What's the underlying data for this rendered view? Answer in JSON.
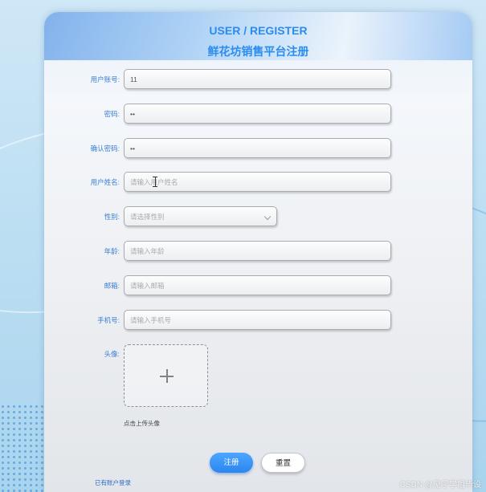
{
  "header": {
    "title_en": "USER / REGISTER",
    "title_cn": "鲜花坊销售平台注册"
  },
  "form": {
    "fields": [
      {
        "label": "用户账号:",
        "value": "11",
        "placeholder": ""
      },
      {
        "label": "密码:",
        "value": "••",
        "placeholder": ""
      },
      {
        "label": "确认密码:",
        "value": "••",
        "placeholder": ""
      },
      {
        "label": "用户姓名:",
        "value": "",
        "placeholder": "请输入用户姓名"
      },
      {
        "label": "性别:",
        "value": "",
        "placeholder": "请选择性别"
      },
      {
        "label": "年龄:",
        "value": "",
        "placeholder": "请输入年龄"
      },
      {
        "label": "邮箱:",
        "value": "",
        "placeholder": "请输入邮箱"
      },
      {
        "label": "手机号:",
        "value": "",
        "placeholder": "请输入手机号"
      }
    ],
    "avatar_label": "头像:",
    "avatar_hint": "点击上传头像"
  },
  "buttons": {
    "register": "注册",
    "reset": "重置"
  },
  "links": {
    "login": "已有账户登录"
  },
  "watermark": "CSDN @见字学姐毕设",
  "colors": {
    "accent": "#2b8cf0",
    "label": "#3a7fd4"
  }
}
